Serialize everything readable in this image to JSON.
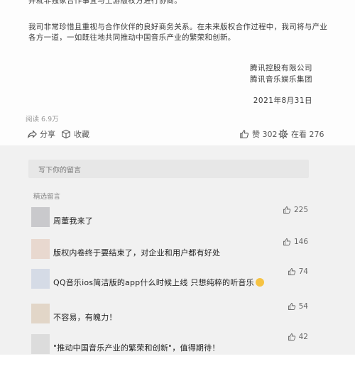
{
  "article": {
    "para0": "并就非独家合作事宜与上游版权方进行协商。",
    "para1": "我司非常珍惜且重视与合作伙伴的良好商务关系。在未来版权合作过程中，我司将与产业各方一道，一如既往地共同推动中国音乐产业的繁荣和创新。",
    "sign_company": "腾讯控股有限公司",
    "sign_group": "腾讯音乐娱乐集团",
    "date": "2021年8月31日",
    "reads": "阅读 6.9万"
  },
  "actions": {
    "share": "分享",
    "favorite": "收藏",
    "like": "赞 302",
    "looking": "在看 276"
  },
  "comments": {
    "write_placeholder": "写下你的留言",
    "section_label": "精选留言",
    "items": [
      {
        "text": "周董我来了",
        "likes": "225",
        "avatar_color": "#c9c9cc"
      },
      {
        "text": "版权内卷终于要结束了，对企业和用户都有好处",
        "likes": "146",
        "avatar_color": "#e8d8cf"
      },
      {
        "text": "QQ音乐ios简洁版的app什么时候上线  只想纯粹的听音乐",
        "likes": "74",
        "avatar_color": "#d5dbe6"
      },
      {
        "text": "不容易，有魄力！",
        "likes": "54",
        "avatar_color": "#e2d6c8"
      },
      {
        "text": "\"推动中国音乐产业的繁荣和创新\"，值得期待！",
        "likes": "42",
        "avatar_color": "#dcdcdc"
      }
    ]
  },
  "icons": {
    "share": "share-arrow-icon",
    "favorite": "cube-icon",
    "like": "thumbs-up-icon",
    "looking": "flower-icon",
    "emoji": "smiley-emoji-icon"
  }
}
